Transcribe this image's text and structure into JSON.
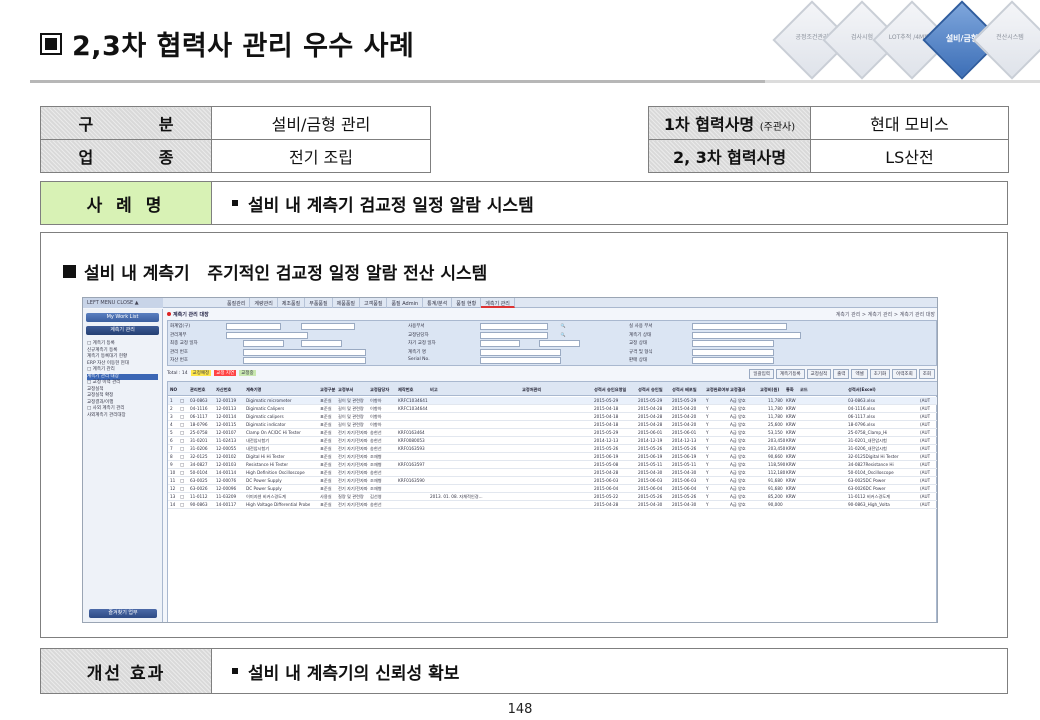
{
  "header": {
    "title": "2,3차 협력사 관리 우수 사례"
  },
  "nav": {
    "items": [
      {
        "label": "공정조건관리",
        "active": false
      },
      {
        "label": "검사시험",
        "active": false
      },
      {
        "label": "LOT추적 /4M변경",
        "active": false
      },
      {
        "label": "설비/금형",
        "active": true
      },
      {
        "label": "전산시스템",
        "active": false
      }
    ]
  },
  "info": {
    "division_label": "구 분",
    "division_value": "설비/금형 관리",
    "industry_label": "업 종",
    "industry_value": "전기 조립",
    "tier1_label": "1차 협력사명",
    "tier1_note": "(주관사)",
    "tier1_value": "현대 모비스",
    "tier23_label": "2, 3차 협력사명",
    "tier23_value": "LS산전"
  },
  "case": {
    "label": "사 례 명",
    "value": "설비 내 계측기 검교정 일정 알람 시스템"
  },
  "main": {
    "heading": "설비 내 계측기   주기적인 검교정 일정 알람 전산 시스템"
  },
  "screenshot": {
    "left_menu_title": "LEFT MENU CLOSE ▲",
    "top_menu": [
      "품질관리",
      "계량관리",
      "제조품질",
      "부품품질",
      "제품품질",
      "고객품질",
      "품질 Admin",
      "통계/분석",
      "품질 현황",
      "계측기 관리"
    ],
    "crumb_left": "계측기 관리 대장",
    "crumb_right": "계측기 관리 > 계측기 관리 > 계측기 관리 대장",
    "my_work": "My Work List",
    "side_title": "계측기 관리",
    "tree": [
      "계측기 등록",
      "신규계측기 등록",
      "계측기 등록대기 현황",
      "ERP 자산 이동현 현대",
      "계측기 관리",
      "계측기 관리 대장",
      "교정 이력 관리",
      "교정실적",
      "교정실적 확정",
      "교정결과/이행",
      "사외 계측기 관리",
      "사외계측기 관리대장"
    ],
    "side_bottom": "즐겨찾기 업무",
    "form": {
      "labels": [
        "화계업(구)",
        "관리계부",
        "최종 교정 일자",
        "관리 번호",
        "자산 번호",
        "사용부서",
        "교정담당자",
        "차기 교정 일자",
        "계측기 명",
        "Serial No.",
        "실 사용 부서",
        "계측기 상태",
        "교정 상태",
        "규격 및 형식",
        "판매 상태"
      ],
      "combo": "--전체--"
    },
    "toolbar_total": "Total : 14",
    "legend": [
      "교정예정",
      "교정 지연",
      "교정중"
    ],
    "buttons": [
      "일괄입력",
      "계측기등록",
      "교정실적",
      "출력",
      "엑셀",
      "초기화",
      "이력조회",
      "조회"
    ],
    "columns": [
      "NO",
      "선택",
      "관리번호",
      "자산번호",
      "계측기명",
      "교정구분",
      "교정부서",
      "교정담당자",
      "제작번호",
      "비고",
      "교정처관리",
      "성적서 승인요청일",
      "성적서 승인일",
      "성적서 배포일",
      "교정완료여부",
      "교정결과",
      "교정비(원)",
      "통화",
      "코드",
      "성적서(Excel)"
    ],
    "rows": [
      [
        "1",
        "03-0863",
        "12-00119",
        "Digimatic micrometer",
        "표준실",
        "길이 및 관련량",
        "이향아",
        "KRFC1034641",
        "",
        "2015-05-29",
        "2015-05-29",
        "2015-05-29",
        "Y",
        "A급 양호",
        "11,780",
        "KRW",
        "03-0863.xlsx"
      ],
      [
        "2",
        "04-1116",
        "12-00113",
        "Digimatic Calipers",
        "표준실",
        "길이 및 관련량",
        "이향아",
        "KRFC1034644",
        "",
        "2015-04-18",
        "2015-04-28",
        "2015-04-20",
        "Y",
        "A급 양호",
        "11,780",
        "KRW",
        "04-1116.xlsx"
      ],
      [
        "3",
        "06-1117",
        "12-00114",
        "Digimatic calipers",
        "표준실",
        "길이 및 관련량",
        "이향아",
        "",
        "",
        "2015-04-18",
        "2015-04-28",
        "2015-04-20",
        "Y",
        "A급 양호",
        "11,780",
        "KRW",
        "06-1117.xlsx"
      ],
      [
        "4",
        "18-0796",
        "12-00115",
        "Digimatic indicator",
        "표준실",
        "길이 및 관련량",
        "이향아",
        "",
        "",
        "2015-04-18",
        "2015-04-28",
        "2015-04-20",
        "Y",
        "A급 양호",
        "25,600",
        "KRW",
        "18-0796.xlsx"
      ],
      [
        "5",
        "25-0758",
        "12-00107",
        "Clamp On AC/DC Hi Tester",
        "표준실",
        "전기 자기/전자파",
        "송현선",
        "KRF0163464",
        "",
        "2015-05-29",
        "2015-06-01",
        "2015-06-01",
        "Y",
        "A급 양호",
        "53,150",
        "KRW",
        "25-0758_Clamp_Hi"
      ],
      [
        "6",
        "31-0201",
        "11-02413",
        "내전압시험기",
        "표준실",
        "전기 자기/전자파",
        "송현선",
        "KRF0080053",
        "",
        "2014-12-13",
        "2014-12-19",
        "2014-12-13",
        "Y",
        "A급 양호",
        "203,450",
        "KRW",
        "31-0201_내전압시험"
      ],
      [
        "7",
        "31-0206",
        "12-00055",
        "내전압시험기",
        "표준실",
        "전기 자기/전자파",
        "송현선",
        "KRF0163593",
        "",
        "2015-05-26",
        "2015-05-26",
        "2015-05-26",
        "Y",
        "A급 양호",
        "203,450",
        "KRW",
        "31-0206_내전압시험"
      ],
      [
        "8",
        "32-0125",
        "12-00102",
        "Digital Hi Hi Tester",
        "표준실",
        "전기 자기/전자파",
        "조재형",
        "",
        "",
        "2015-06-19",
        "2015-06-19",
        "2015-06-19",
        "Y",
        "A급 양호",
        "90,660",
        "KRW",
        "32-0125Digital Hi Tester"
      ],
      [
        "9",
        "34-0827",
        "12-00103",
        "Resistance Hi Tester",
        "표준실",
        "전기 자기/전자파",
        "조재형",
        "KRF0163597",
        "",
        "2015-05-08",
        "2015-05-11",
        "2015-05-11",
        "Y",
        "A급 양호",
        "118,590",
        "KRW",
        "34-0827Resistance Hi"
      ],
      [
        "10",
        "50-0104",
        "14-00114",
        "High Definition Oscilloscope",
        "표준실",
        "전기 자기/전자파",
        "송현선",
        "",
        "",
        "2015-04-28",
        "2015-04-30",
        "2015-04-30",
        "Y",
        "A급 양호",
        "112,180",
        "KRW",
        "50-0104_Oscilloscope"
      ],
      [
        "11",
        "63-0025",
        "12-00076",
        "DC Power Supply",
        "표준실",
        "전기 자기/전자파",
        "조재형",
        "KRF0163590",
        "",
        "2015-06-03",
        "2015-06-03",
        "2015-06-03",
        "Y",
        "A급 양호",
        "91,680",
        "KRW",
        "63-0025DC Power"
      ],
      [
        "12",
        "63-0026",
        "12-00096",
        "DC Power Supply",
        "표준실",
        "전기 자기/전자파",
        "조재형",
        "",
        "",
        "2015-06-04",
        "2015-06-04",
        "2015-06-04",
        "Y",
        "A급 양호",
        "91,680",
        "KRW",
        "63-0026DC Power"
      ],
      [
        "13",
        "11-0112",
        "11-03209",
        "이미지센 비커스경도계",
        "사용실",
        "질량 및 관련량",
        "김선영",
        "",
        "2013. 01. 08. 자체적인경...",
        "2015-05-22",
        "2015-05-26",
        "2015-05-26",
        "Y",
        "A급 양호",
        "85,200",
        "KRW",
        "11-0112 비커스경도계"
      ],
      [
        "14",
        "90-0863",
        "14-00117",
        "High Voltage Differential Probe",
        "표준실",
        "전기 자기/전자파",
        "송현선",
        "",
        "",
        "2015-04-28",
        "2015-04-30",
        "2015-04-30",
        "Y",
        "A급 양호",
        "90,000",
        "",
        "90-0863_High_Volta"
      ]
    ]
  },
  "effect": {
    "label": "개선 효과",
    "value": "설비 내 계측기의 신뢰성 확보"
  },
  "footer": {
    "page_number": "148"
  },
  "colors": {
    "case_label_bg": "#d8f2b5",
    "nav_active": "#3d6fb7",
    "hatch_bg": "#d9d9d9"
  }
}
